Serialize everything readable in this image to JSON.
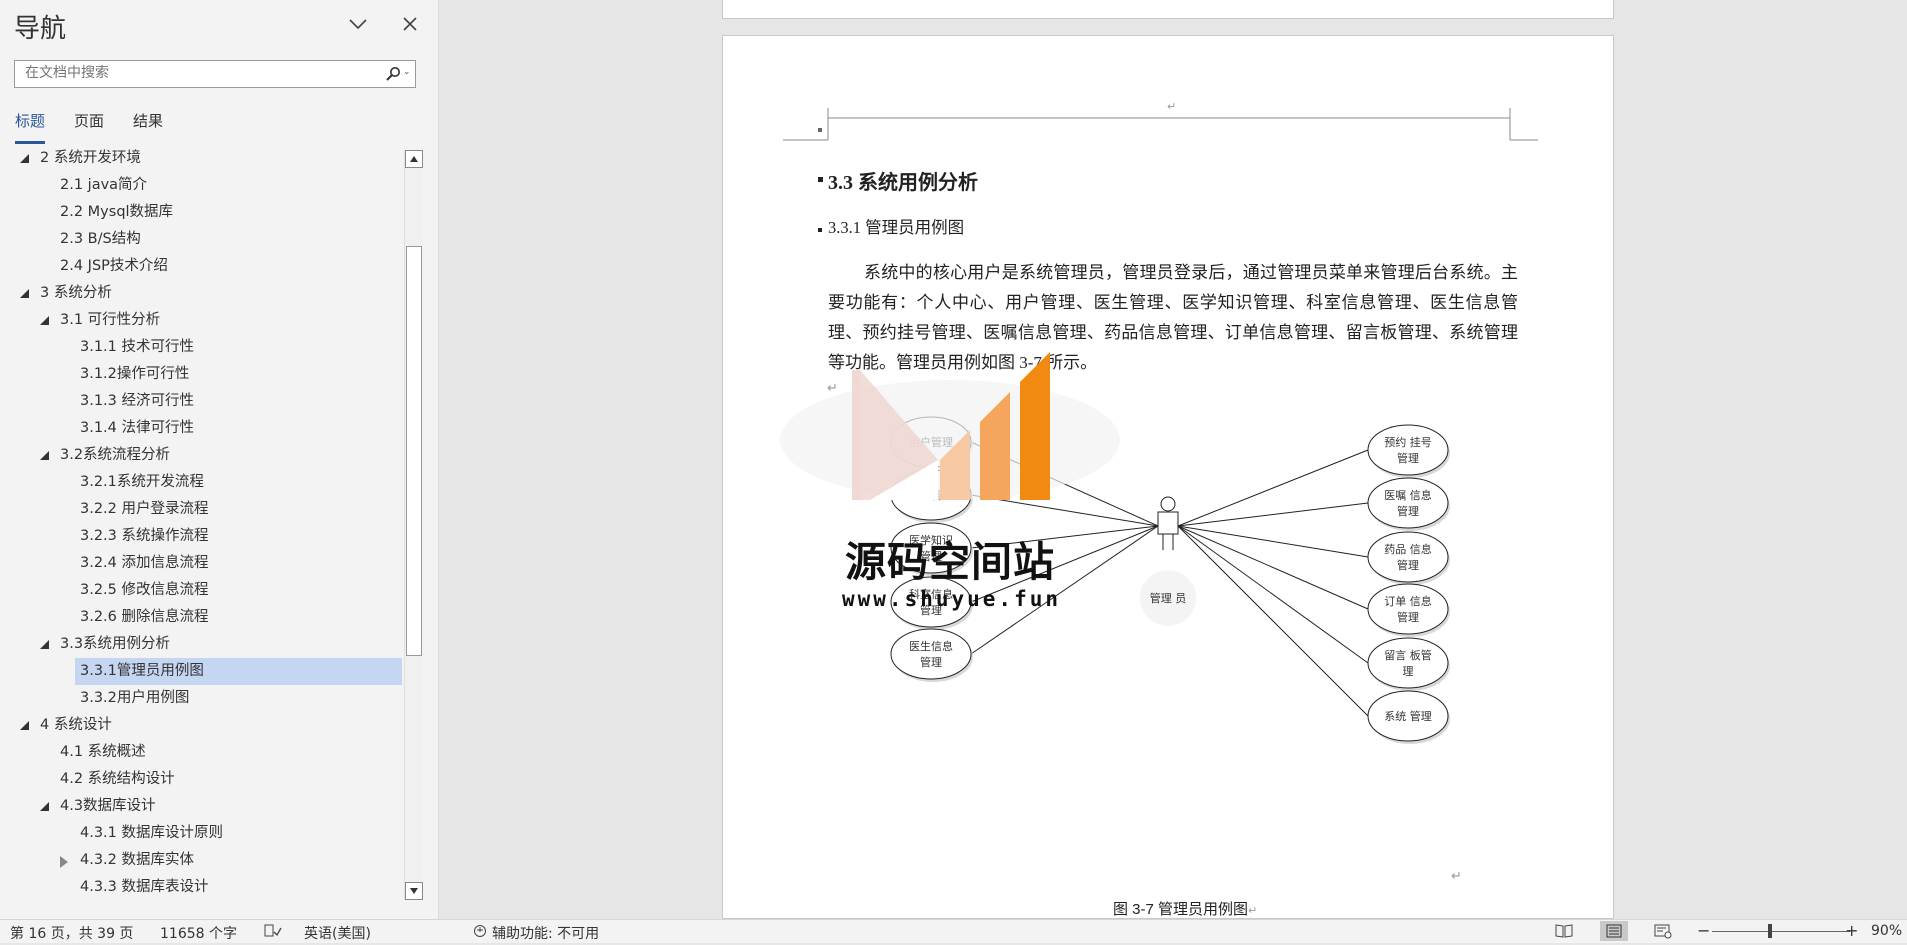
{
  "nav": {
    "title": "导航",
    "search_placeholder": "在文档中搜索",
    "tabs": [
      "标题",
      "页面",
      "结果"
    ],
    "tree": [
      {
        "label": "2 系统开发环境",
        "level": 1,
        "expand": "open"
      },
      {
        "label": "2.1 java简介",
        "level": 2,
        "expand": "none"
      },
      {
        "label": "2.2 Mysql数据库",
        "level": 2,
        "expand": "none"
      },
      {
        "label": "2.3 B/S结构",
        "level": 2,
        "expand": "none"
      },
      {
        "label": "2.4 JSP技术介绍",
        "level": 2,
        "expand": "none"
      },
      {
        "label": "3 系统分析",
        "level": 1,
        "expand": "open"
      },
      {
        "label": "3.1 可行性分析",
        "level": 2,
        "expand": "open"
      },
      {
        "label": "3.1.1 技术可行性",
        "level": 3,
        "expand": "none"
      },
      {
        "label": "3.1.2操作可行性",
        "level": 3,
        "expand": "none"
      },
      {
        "label": "3.1.3 经济可行性",
        "level": 3,
        "expand": "none"
      },
      {
        "label": "3.1.4 法律可行性",
        "level": 3,
        "expand": "none"
      },
      {
        "label": "3.2系统流程分析",
        "level": 2,
        "expand": "open"
      },
      {
        "label": "3.2.1系统开发流程",
        "level": 3,
        "expand": "none"
      },
      {
        "label": "3.2.2 用户登录流程",
        "level": 3,
        "expand": "none"
      },
      {
        "label": "3.2.3 系统操作流程",
        "level": 3,
        "expand": "none"
      },
      {
        "label": "3.2.4 添加信息流程",
        "level": 3,
        "expand": "none"
      },
      {
        "label": "3.2.5 修改信息流程",
        "level": 3,
        "expand": "none"
      },
      {
        "label": "3.2.6 删除信息流程",
        "level": 3,
        "expand": "none"
      },
      {
        "label": "3.3系统用例分析",
        "level": 2,
        "expand": "open"
      },
      {
        "label": "3.3.1管理员用例图",
        "level": 3,
        "expand": "none",
        "selected": true
      },
      {
        "label": "3.3.2用户用例图",
        "level": 3,
        "expand": "none"
      },
      {
        "label": "4 系统设计",
        "level": 1,
        "expand": "open"
      },
      {
        "label": "4.1 系统概述",
        "level": 2,
        "expand": "none"
      },
      {
        "label": "4.2 系统结构设计",
        "level": 2,
        "expand": "none"
      },
      {
        "label": "4.3数据库设计",
        "level": 2,
        "expand": "open"
      },
      {
        "label": "4.3.1 数据库设计原则",
        "level": 3,
        "expand": "none"
      },
      {
        "label": "4.3.2 数据库实体",
        "level": 3,
        "expand": "closed"
      },
      {
        "label": "4.3.3 数据库表设计",
        "level": 3,
        "expand": "none"
      }
    ]
  },
  "doc": {
    "heading_h2": "3.3 系统用例分析",
    "heading_h3": "3.3.1 管理员用例图",
    "paragraph": "系统中的核心用户是系统管理员，管理员登录后，通过管理员菜单来管理后台系统。主要功能有：个人中心、用户管理、医生管理、医学知识管理、科室信息管理、医生信息管理、预约挂号管理、医嘱信息管理、药品信息管理、订单信息管理、留言板管理、系统管理等功能。管理员用例如图 3-7 所示。",
    "return_mark": "↵",
    "caption": "图 3-7  管理员用例图",
    "diagram": {
      "actor": "管理 员",
      "left_usecases": [
        [
          "用户管理"
        ],
        [
          "医生管理"
        ],
        [
          "医学知识",
          "管理"
        ],
        [
          "科室信息",
          "管理"
        ],
        [
          "医生信息",
          "管理"
        ]
      ],
      "right_usecases": [
        [
          "预约 挂号",
          "管理"
        ],
        [
          "医嘱 信息",
          "管理"
        ],
        [
          "药品 信息",
          "管理"
        ],
        [
          "订单 信息",
          "管理"
        ],
        [
          "留言 板管",
          "理"
        ],
        [
          "系统 管理"
        ]
      ]
    },
    "watermark": {
      "title": "源码空间站",
      "url": "www.shuyue.fun",
      "colors": [
        "#f0d8d4",
        "#f7c8a4",
        "#f5a55c",
        "#f59a30",
        "#f08a10"
      ]
    }
  },
  "status": {
    "page_info": "第 16 页，共 39 页",
    "word_count": "11658 个字",
    "language": "英语(美国)",
    "accessibility": "辅助功能: 不可用",
    "zoom": "90%",
    "zoom_minus": "−",
    "zoom_plus": "+"
  },
  "colors": {
    "accent": "#2b579a",
    "selected_bg": "#c5d6f2"
  }
}
